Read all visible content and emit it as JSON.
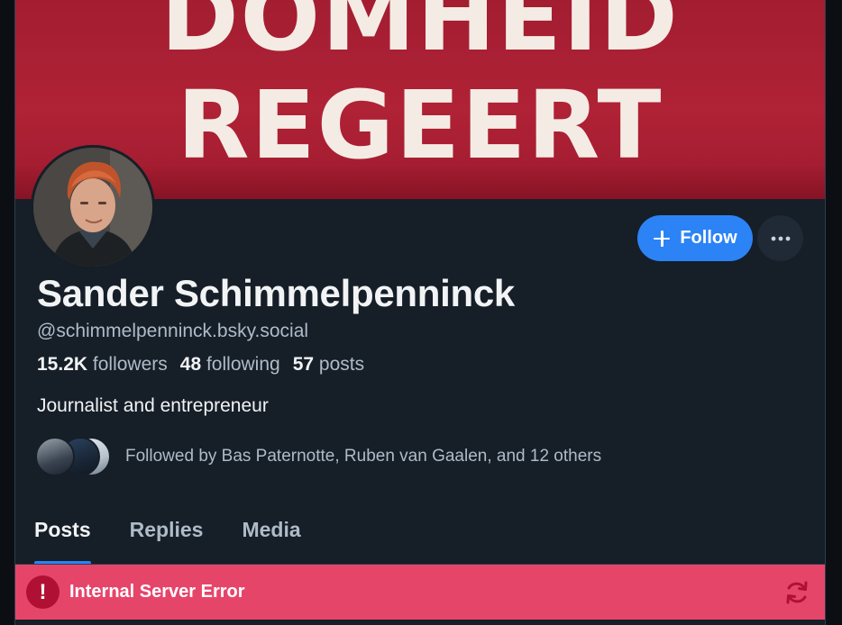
{
  "banner": {
    "line1": "DOMHEID",
    "line2": "REGEERT"
  },
  "profile": {
    "display_name": "Sander Schimmelpenninck",
    "handle": "@schimmelpenninck.bsky.social",
    "bio": "Journalist and entrepreneur"
  },
  "stats": {
    "followers_count": "15.2K",
    "followers_label": "followers",
    "following_count": "48",
    "following_label": "following",
    "posts_count": "57",
    "posts_label": "posts"
  },
  "actions": {
    "follow_label": "Follow",
    "more_icon": "ellipsis-icon"
  },
  "followed_by": {
    "text": "Followed by Bas Paternotte, Ruben van Gaalen, and 12 others"
  },
  "tabs": [
    {
      "label": "Posts",
      "active": true
    },
    {
      "label": "Replies",
      "active": false
    },
    {
      "label": "Media",
      "active": false
    }
  ],
  "error": {
    "message": "Internal Server Error",
    "icon": "exclamation-icon",
    "retry_icon": "refresh-icon"
  },
  "colors": {
    "accent": "#2b83f6",
    "error": "#e6456a",
    "banner": "#a31d31",
    "background": "#161e27"
  }
}
